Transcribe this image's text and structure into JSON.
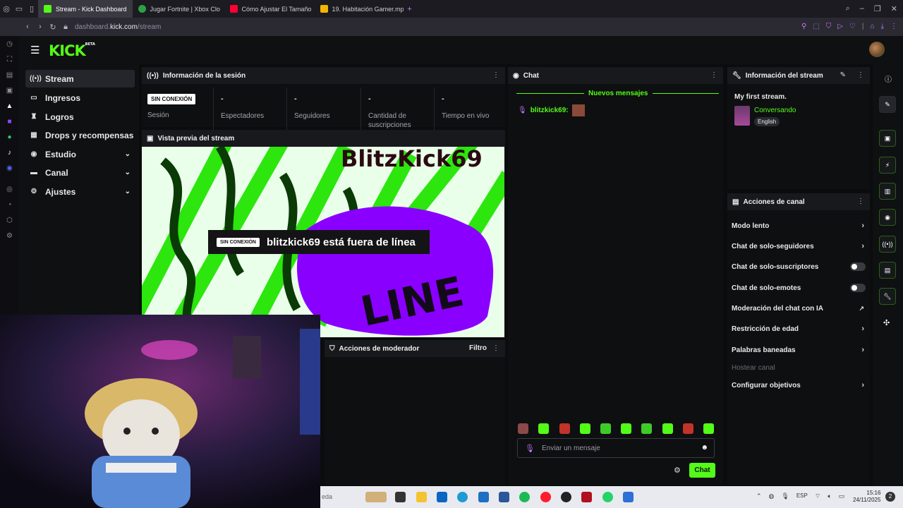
{
  "browser": {
    "tabs": [
      {
        "label": "Stream - Kick Dashboard",
        "color": "#53fc18"
      },
      {
        "label": "Jugar Fortnite | Xbox Clo",
        "color": "#2ea043"
      },
      {
        "label": "Cómo Ajustar El Tamaño",
        "color": "#ff0033"
      },
      {
        "label": "19. Habitación Gamer.mp·",
        "color": "#f4b400"
      }
    ],
    "new_tab": "+",
    "url_sub": "dashboard.",
    "url_main": "kick.com",
    "url_path": "/stream"
  },
  "logo": {
    "text": "KICK",
    "beta": "BETA"
  },
  "nav": {
    "items": [
      {
        "label": "Stream",
        "icon": "stream-icon"
      },
      {
        "label": "Ingresos",
        "icon": "money-icon"
      },
      {
        "label": "Logros",
        "icon": "trophy-icon"
      },
      {
        "label": "Drops y recompensas",
        "icon": "gift-icon"
      },
      {
        "label": "Estudio",
        "icon": "studio-icon"
      },
      {
        "label": "Canal",
        "icon": "channel-icon"
      },
      {
        "label": "Ajustes",
        "icon": "gear-icon"
      }
    ]
  },
  "session": {
    "title": "Información de la sesión",
    "status": "SIN CONEXIÓN",
    "status_label": "Sesión",
    "stats": [
      {
        "value": "-",
        "label": "Espectadores"
      },
      {
        "value": "-",
        "label": "Seguidores"
      },
      {
        "value": "-",
        "label": "Cantidad de suscripciones"
      },
      {
        "value": "-",
        "label": "Tiempo en vivo"
      }
    ]
  },
  "preview": {
    "title": "Vista previa del stream",
    "banner_text": "BlitzKick69",
    "offline_badge": "SIN CONEXIÓN",
    "offline_text": "blitzkick69 está fuera de línea",
    "art_text": "LINE"
  },
  "moderator": {
    "title": "Acciones de moderador",
    "filter": "Filtro"
  },
  "chat": {
    "title": "Chat",
    "divider": "Nuevos mensajes",
    "messages": [
      {
        "user": "blitzkick69:"
      }
    ],
    "input_placeholder": "Enviar un mensaje",
    "send_label": "Chat"
  },
  "stream_info": {
    "title": "Información del stream",
    "stream_title": "My first stream.",
    "category": "Conversando",
    "language": "English"
  },
  "channel_actions": {
    "title": "Acciones de canal",
    "items": [
      {
        "label": "Modo lento",
        "control": "arrow"
      },
      {
        "label": "Chat de solo-seguidores",
        "control": "arrow"
      },
      {
        "label": "Chat de solo-suscriptores",
        "control": "toggle"
      },
      {
        "label": "Chat de solo-emotes",
        "control": "toggle"
      },
      {
        "label": "Moderación del chat con IA",
        "control": "external"
      },
      {
        "label": "Restricción de edad",
        "control": "arrow"
      },
      {
        "label": "Palabras baneadas",
        "control": "arrow"
      },
      {
        "label": "Hostear canal",
        "control": "none"
      },
      {
        "label": "Configurar objetivos",
        "control": "arrow"
      }
    ]
  },
  "taskbar": {
    "search_text": "eda",
    "language": "ESP",
    "time": "15:16",
    "date": "24/11/2025",
    "notifications": "2"
  },
  "colors": {
    "accent": "#53fc18",
    "purple": "#8a00ff"
  }
}
